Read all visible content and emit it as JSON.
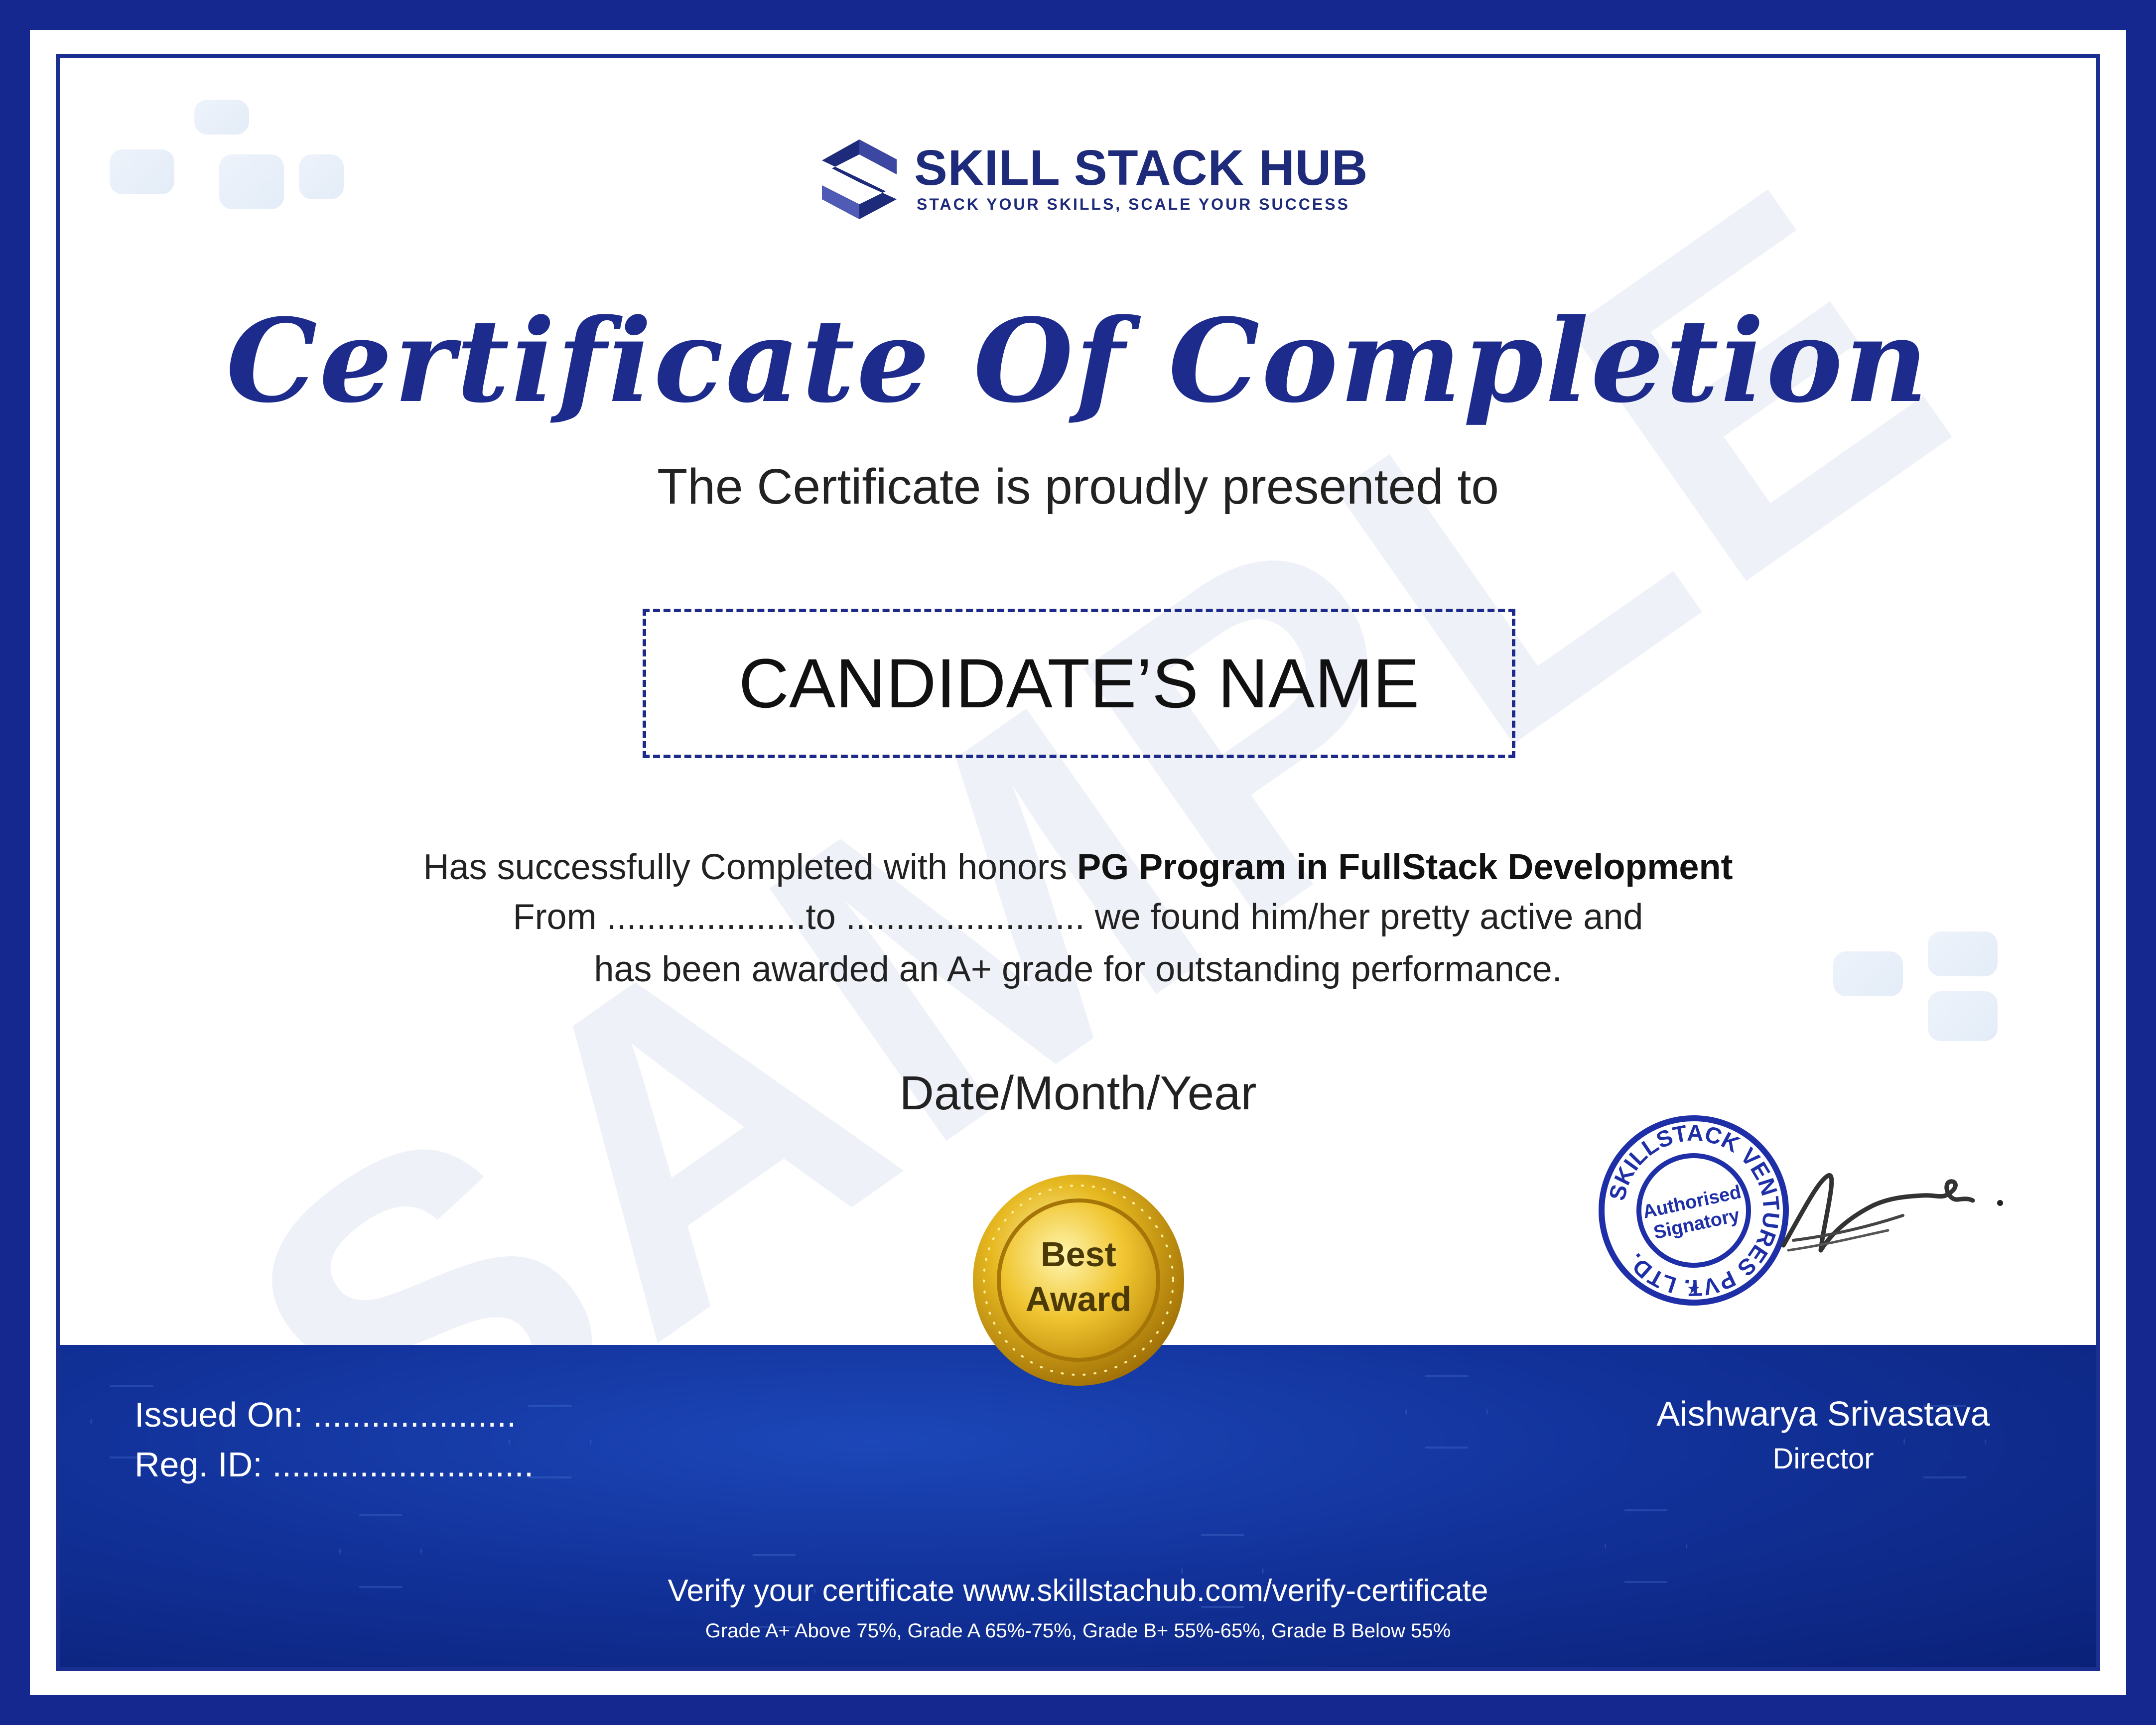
{
  "brand": {
    "name": "SKILL STACK HUB",
    "tagline": "STACK YOUR SKILLS, SCALE YOUR SUCCESS",
    "color": "#1e2a7a"
  },
  "watermark": "SAMPLE",
  "certificate": {
    "title": "Certificate Of Completion",
    "presented_to": "The Certificate is proudly presented to",
    "candidate_name": "CANDIDATE’S NAME",
    "line1_prefix": "Has successfully Completed with honors ",
    "program": "PG Program in FullStack Development",
    "line2": "From ....................to ........................ we found him/her pretty active and",
    "line3": "has been awarded an A+ grade for outstanding performance.",
    "date": "Date/Month/Year"
  },
  "medal": {
    "line1": "Best",
    "line2": "Award"
  },
  "stamp": {
    "ring_text": "SKILLSTACK VENTURES PVT. LTD.",
    "center_line1": "Authorised",
    "center_line2": "Signatory"
  },
  "footer": {
    "issued_on": "Issued On: .....................",
    "reg_id": "Reg. ID: ...........................",
    "signer_name": "Aishwarya Srivastava",
    "signer_role": "Director",
    "verify_text": "Verify your certificate www.skillstachub.com/verify-certificate",
    "grades_text": "Grade A+ Above 75%, Grade A 65%-75%, Grade B+ 55%-65%, Grade B Below 55%"
  },
  "colors": {
    "border": "#14288f",
    "title": "#1d2b8c",
    "footer_band": "#12329a",
    "medal_gold": "#e0b21f"
  }
}
